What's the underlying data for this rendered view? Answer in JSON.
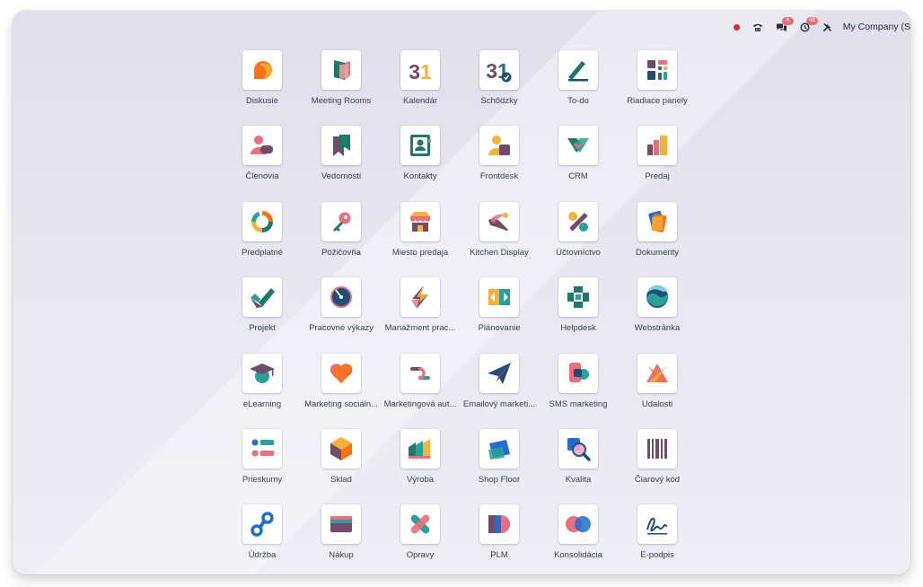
{
  "systray": {
    "chat_badge": "4",
    "activity_badge": "48",
    "company": "My Company (S"
  },
  "apps": [
    {
      "label": "Diskusie",
      "icon": "discuss-icon"
    },
    {
      "label": "Meeting Rooms",
      "icon": "meeting-rooms-icon"
    },
    {
      "label": "Kalendár",
      "icon": "calendar-icon"
    },
    {
      "label": "Schôdzky",
      "icon": "appointments-icon"
    },
    {
      "label": "To-do",
      "icon": "todo-icon"
    },
    {
      "label": "Riadiace panely",
      "icon": "dashboards-icon"
    },
    {
      "label": "Členovia",
      "icon": "members-icon"
    },
    {
      "label": "Vedomosti",
      "icon": "knowledge-icon"
    },
    {
      "label": "Kontakty",
      "icon": "contacts-icon"
    },
    {
      "label": "Frontdesk",
      "icon": "frontdesk-icon"
    },
    {
      "label": "CRM",
      "icon": "crm-icon"
    },
    {
      "label": "Predaj",
      "icon": "sales-icon"
    },
    {
      "label": "Predplatné",
      "icon": "subscriptions-icon"
    },
    {
      "label": "Požičovňa",
      "icon": "rental-icon"
    },
    {
      "label": "Miesto predaja",
      "icon": "point-of-sale-icon"
    },
    {
      "label": "Kitchen Display",
      "icon": "kitchen-display-icon"
    },
    {
      "label": "Účtovníctvo",
      "icon": "accounting-icon"
    },
    {
      "label": "Dokumenty",
      "icon": "documents-icon"
    },
    {
      "label": "Projekt",
      "icon": "project-icon"
    },
    {
      "label": "Pracovné výkazy",
      "icon": "timesheets-icon"
    },
    {
      "label": "Manažment prac...",
      "icon": "planning-management-icon"
    },
    {
      "label": "Plánovanie",
      "icon": "planning-icon"
    },
    {
      "label": "Helpdesk",
      "icon": "helpdesk-icon"
    },
    {
      "label": "Webstránka",
      "icon": "website-icon"
    },
    {
      "label": "eLearning",
      "icon": "elearning-icon"
    },
    {
      "label": "Marketing sociáln...",
      "icon": "social-marketing-icon"
    },
    {
      "label": "Marketingová aut...",
      "icon": "marketing-automation-icon"
    },
    {
      "label": "Emailový marketi...",
      "icon": "email-marketing-icon"
    },
    {
      "label": "SMS marketing",
      "icon": "sms-marketing-icon"
    },
    {
      "label": "Udalosti",
      "icon": "events-icon"
    },
    {
      "label": "Prieskumy",
      "icon": "surveys-icon"
    },
    {
      "label": "Sklad",
      "icon": "inventory-icon"
    },
    {
      "label": "Výroba",
      "icon": "manufacturing-icon"
    },
    {
      "label": "Shop Floor",
      "icon": "shop-floor-icon"
    },
    {
      "label": "Kvalita",
      "icon": "quality-icon"
    },
    {
      "label": "Čiarový kód",
      "icon": "barcode-icon"
    },
    {
      "label": "Údržba",
      "icon": "maintenance-icon"
    },
    {
      "label": "Nákup",
      "icon": "purchase-icon"
    },
    {
      "label": "Opravy",
      "icon": "repairs-icon"
    },
    {
      "label": "PLM",
      "icon": "plm-icon"
    },
    {
      "label": "Konsolidácia",
      "icon": "consolidation-icon"
    },
    {
      "label": "E-podpis",
      "icon": "sign-icon"
    }
  ]
}
